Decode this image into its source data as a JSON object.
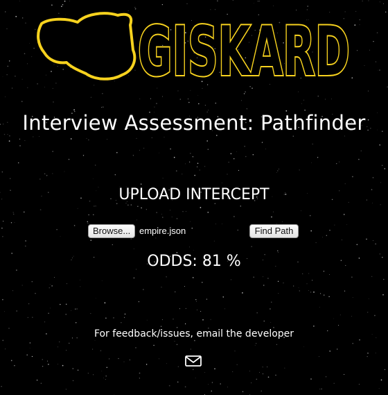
{
  "logo": {
    "text": "GISKARD",
    "color": "#f7d21e"
  },
  "title": "Interview Assessment: Pathfinder",
  "upload": {
    "heading": "UPLOAD INTERCEPT",
    "browse_label": "Browse...",
    "file_name": "empire.json",
    "find_label": "Find Path"
  },
  "odds": {
    "label": "ODDS:",
    "value": "81 %"
  },
  "footer": {
    "feedback_text": "For feedback/issues, email the developer",
    "mail_icon": "envelope-icon"
  }
}
